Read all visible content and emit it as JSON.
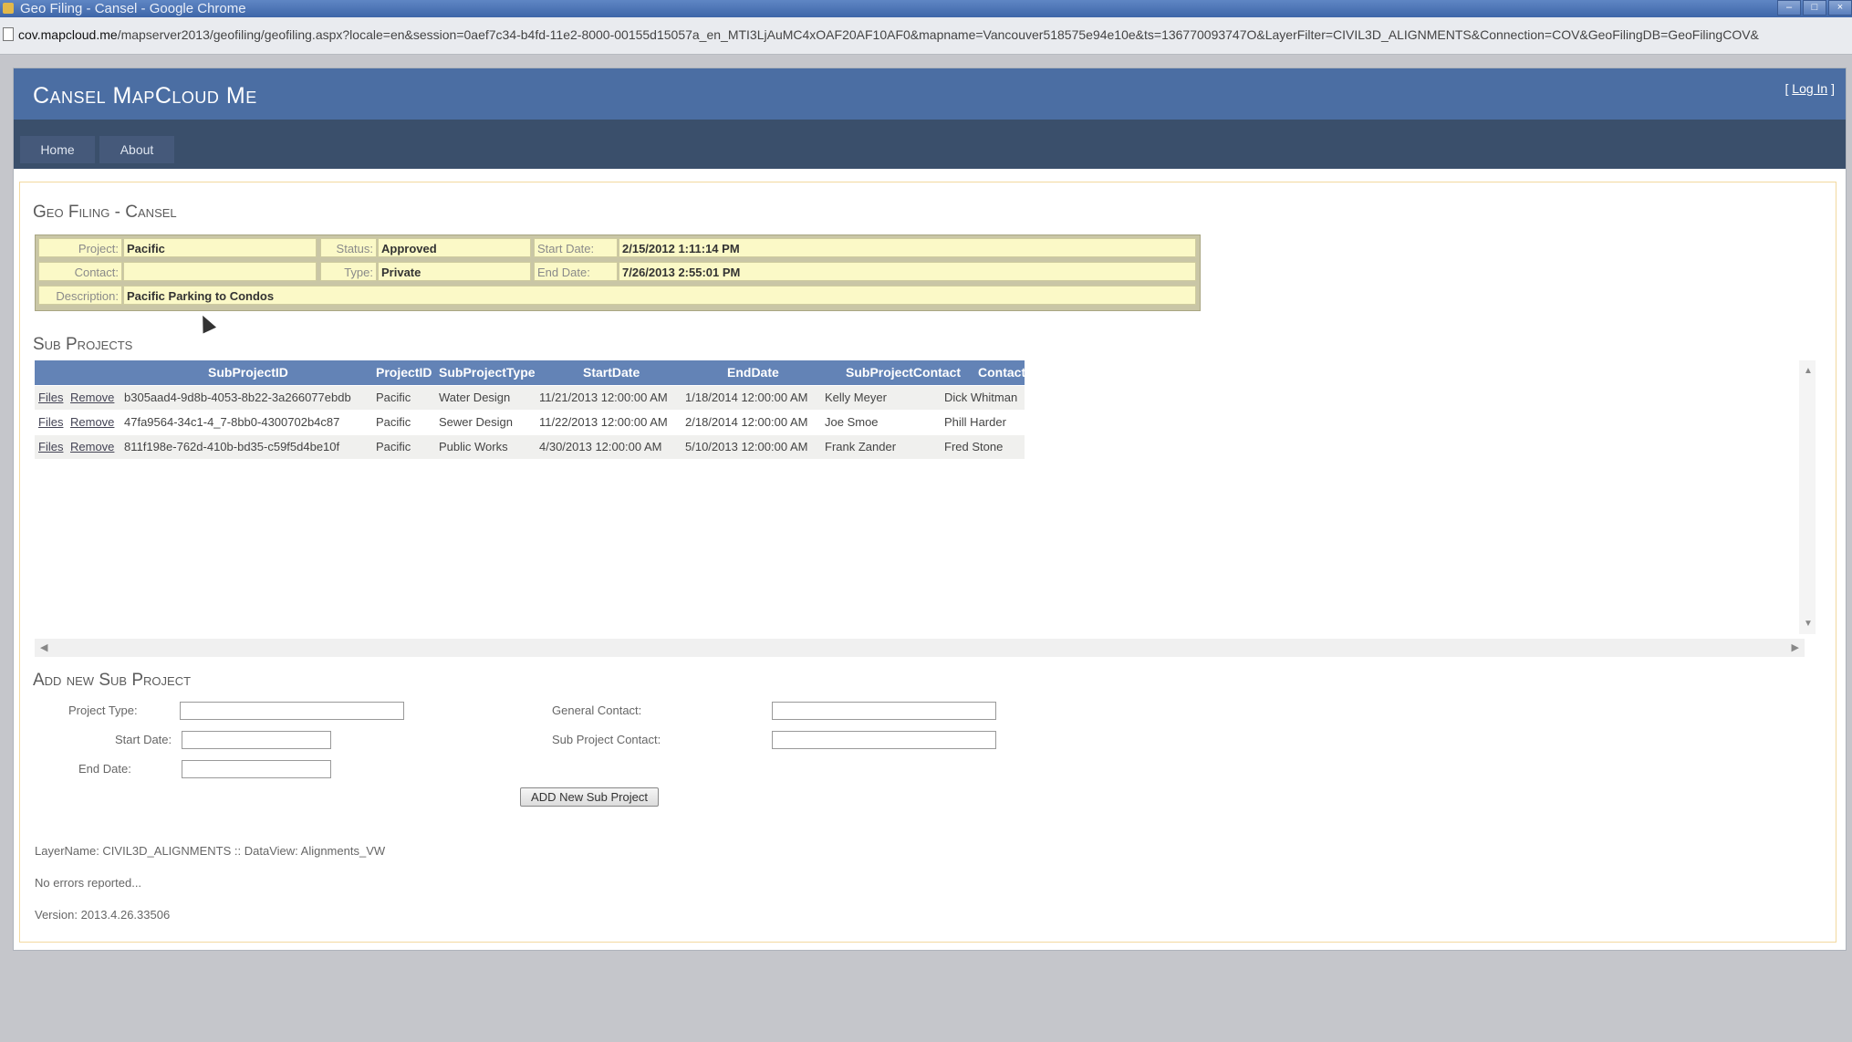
{
  "browser": {
    "window_title": "Geo Filing - Cansel - Google Chrome",
    "url_host": "cov.mapcloud.me",
    "url_path": "/mapserver2013/geofiling/geofiling.aspx?locale=en&session=0aef7c34-b4fd-11e2-8000-00155d15057a_en_MTI3LjAuMC4xOAF20AF10AF0&mapname=Vancouver518575e94e10e&ts=136770093747O&LayerFilter=CIVIL3D_ALIGNMENTS&Connection=COV&GeoFilingDB=GeoFilingCOV&"
  },
  "header": {
    "brand": "Cansel MapCloud Me",
    "login_open": "[ ",
    "login_link": "Log In",
    "login_close": " ]"
  },
  "menu": {
    "home": "Home",
    "about": "About"
  },
  "page_title": "Geo Filing - Cansel",
  "project": {
    "project_label": "Project:",
    "project_value": "Pacific",
    "status_label": "Status:",
    "status_value": "Approved",
    "start_label": "Start Date:",
    "start_value": "2/15/2012 1:11:14 PM",
    "contact_label": "Contact:",
    "contact_value": "",
    "type_label": "Type:",
    "type_value": "Private",
    "end_label": "End Date:",
    "end_value": "7/26/2013 2:55:01 PM",
    "desc_label": "Description:",
    "desc_value": "Pacific Parking to Condos"
  },
  "sub_projects": {
    "title": "Sub Projects",
    "columns": [
      "SubProjectID",
      "ProjectID",
      "SubProjectType",
      "StartDate",
      "EndDate",
      "SubProjectContact",
      "Contact"
    ],
    "files_link": "Files",
    "remove_link": "Remove",
    "rows": [
      [
        "b305aad4-9d8b-4053-8b22-3a266077ebdb",
        "Pacific",
        "Water Design",
        "11/21/2013 12:00:00 AM",
        "1/18/2014 12:00:00 AM",
        "Kelly Meyer",
        "Dick Whitman"
      ],
      [
        "47fa9564-34c1-4_7-8bb0-4300702b4c87",
        "Pacific",
        "Sewer Design",
        "11/22/2013 12:00:00 AM",
        "2/18/2014 12:00:00 AM",
        "Joe Smoe",
        "Phill Harder"
      ],
      [
        "811f198e-762d-410b-bd35-c59f5d4be10f",
        "Pacific",
        "Public Works",
        "4/30/2013 12:00:00 AM",
        "5/10/2013 12:00:00 AM",
        "Frank Zander",
        "Fred Stone"
      ]
    ]
  },
  "add_form": {
    "title": "Add new Sub Project",
    "project_type_label": "Project Type:",
    "start_date_label": "Start Date:",
    "end_date_label": "End Date:",
    "general_contact_label": "General Contact:",
    "sub_project_contact_label": "Sub Project Contact:",
    "add_button": "ADD New Sub Project"
  },
  "footer": {
    "layer_info": "LayerName: CIVIL3D_ALIGNMENTS :: DataView: Alignments_VW",
    "errors": "No errors reported...",
    "version": "Version: 2013.4.26.33506"
  }
}
